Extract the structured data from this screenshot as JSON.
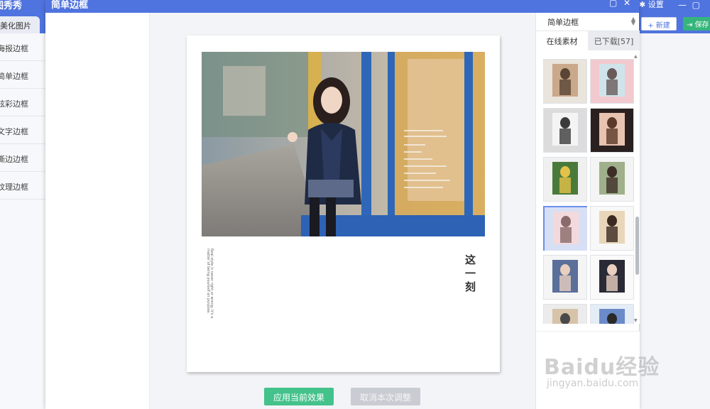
{
  "app": {
    "title": "图秀秀",
    "tab_label": "美化图片",
    "settings_label": "设置",
    "new_button": "+ 新建",
    "save_button": "保存",
    "sidebar": [
      {
        "label": "海报边框"
      },
      {
        "label": "简单边框"
      },
      {
        "label": "炫彩边框"
      },
      {
        "label": "文字边框"
      },
      {
        "label": "撕边边框"
      },
      {
        "label": "纹理边框"
      }
    ]
  },
  "modal": {
    "title": "简单边框",
    "poster": {
      "vertical_caption": "Real style is never right or wrong. It's a matter of being yourself on purpose.",
      "big_title": "这一刻"
    },
    "buttons": {
      "apply": "应用当前效果",
      "cancel": "取消本次调整"
    },
    "materials": {
      "select_value": "简单边框",
      "tabs": [
        "在线素材",
        "已下载[57]"
      ],
      "thumbnail_count_visible": 12,
      "selected_index": 6
    }
  },
  "watermark": {
    "brand": "Baidu经验",
    "url": "jingyan.baidu.com"
  },
  "colors": {
    "title_bar": "#4f73df",
    "apply_green": "#44c28b",
    "cancel_gray": "#c9ccd3",
    "selected_border": "#6b8ff0"
  }
}
